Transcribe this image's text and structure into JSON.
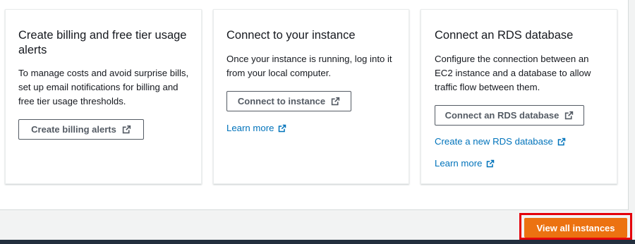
{
  "cards": [
    {
      "title": "Create billing and free tier usage alerts",
      "description": "To manage costs and avoid surprise bills, set up email notifications for billing and free tier usage thresholds.",
      "button_label": "Create billing alerts"
    },
    {
      "title": "Connect to your instance",
      "description": "Once your instance is running, log into it from your local computer.",
      "button_label": "Connect to instance",
      "link_label": "Learn more"
    },
    {
      "title": "Connect an RDS database",
      "description": "Configure the connection between an EC2 instance and a database to allow traffic flow between them.",
      "button_label": "Connect an RDS database",
      "link_create_label": "Create a new RDS database",
      "link_learn_label": "Learn more"
    }
  ],
  "footer": {
    "primary_button_label": "View all instances"
  },
  "colors": {
    "primary": "#ec7211",
    "link": "#0073bb",
    "highlight": "#e4000b",
    "bottom_bar": "#232f3e"
  },
  "icons": {
    "external_link": "external-link-icon"
  }
}
